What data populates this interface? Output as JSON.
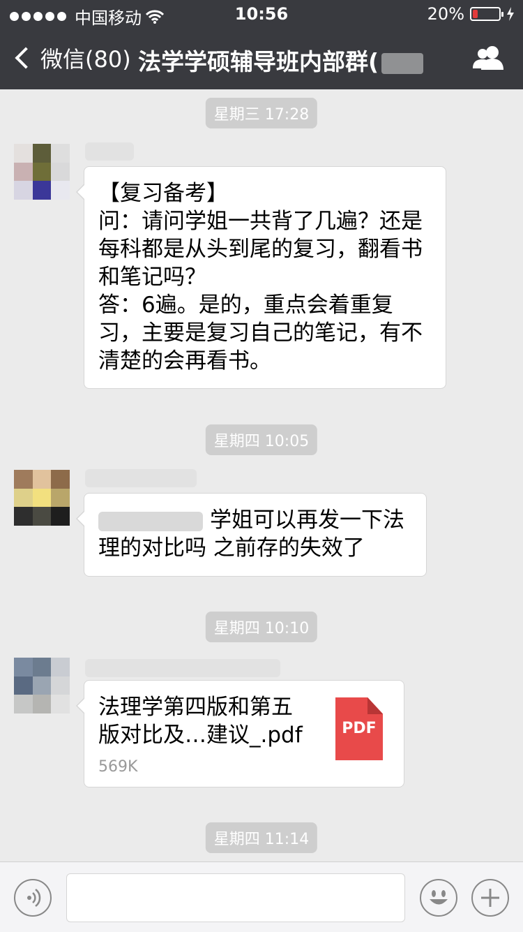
{
  "status": {
    "carrier": "中国移动",
    "time": "10:56",
    "battery_percent": "20%",
    "battery_level": 0.2,
    "icons": [
      "signal-dots-icon",
      "wifi-icon",
      "battery-icon",
      "charging-bolt-icon"
    ]
  },
  "nav": {
    "back_label": "微信(80)",
    "title": "法学学硕辅导班内部群(",
    "right_icon": "group-members-icon"
  },
  "timestamps": [
    "星期三 17:28",
    "星期四 10:05",
    "星期四 10:10",
    "星期四 11:14"
  ],
  "messages": [
    {
      "lines": [
        "【复习备考】",
        "问：请问学姐一共背了几遍？还是",
        "每科都是从头到尾的复习，翻看书",
        "和笔记吗？",
        "答：6遍。是的，重点会着重复",
        "习，主要是复习自己的笔记，有不",
        "清楚的会再看书。"
      ]
    },
    {
      "lines": [
        "学姐可以再发一下法",
        "理的对比吗 之前存的失效了"
      ]
    },
    {
      "file": {
        "name_lines": [
          "法理学第四版和第五",
          "版对比及…建议_.pdf"
        ],
        "size": "569K",
        "icon_label": "PDF",
        "icon_color": "#e84a4a"
      }
    }
  ],
  "input": {
    "voice_icon": "voice-icon",
    "emoji_icon": "emoji-icon",
    "plus_icon": "plus-icon"
  }
}
